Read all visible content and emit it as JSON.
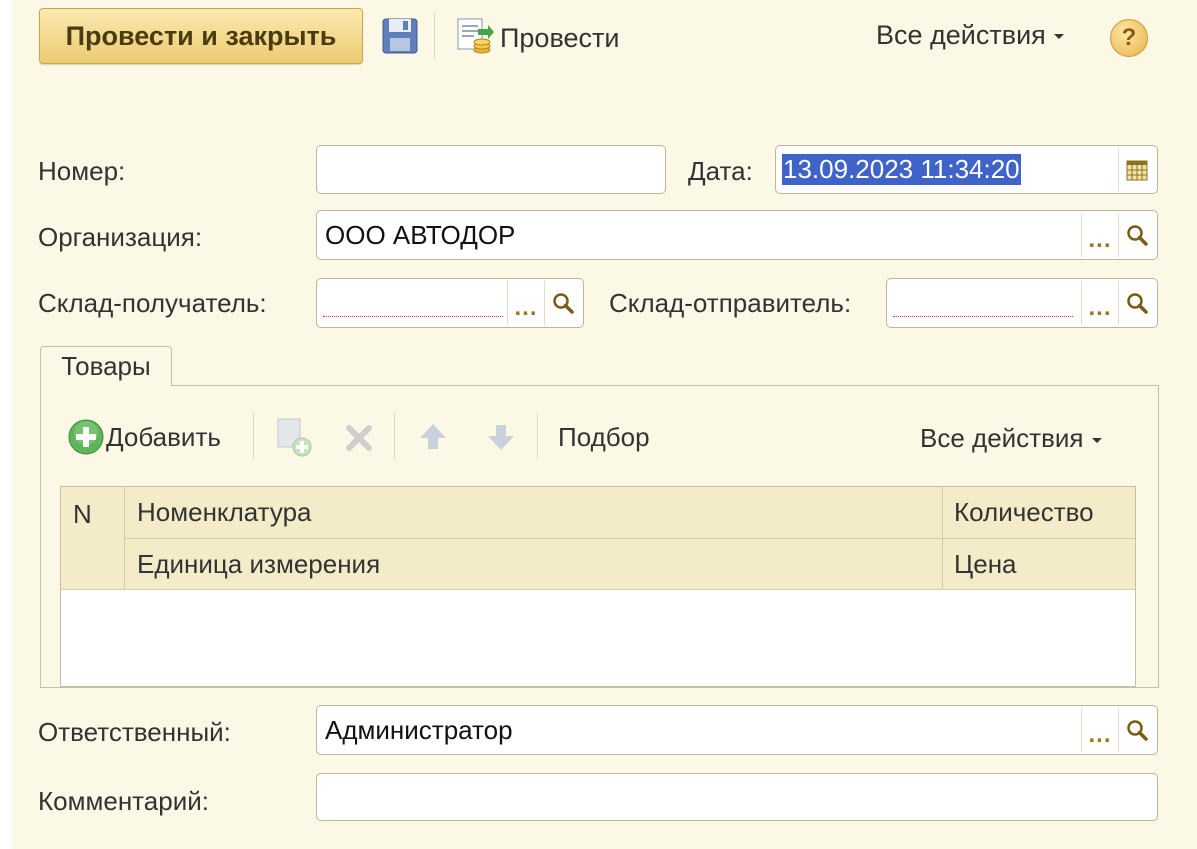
{
  "toolbar": {
    "post_and_close_label": "Провести и закрыть",
    "post_label": "Провести",
    "all_actions_label": "Все действия",
    "help_symbol": "?"
  },
  "form": {
    "number_label": "Номер:",
    "number_value": "",
    "date_label": "Дата:",
    "date_value": "13.09.2023 11:34:20",
    "organization_label": "Организация:",
    "organization_value": "ООО АВТОДОР",
    "warehouse_to_label": "Склад-получатель:",
    "warehouse_to_value": "",
    "warehouse_from_label": "Склад-отправитель:",
    "warehouse_from_value": "",
    "responsible_label": "Ответственный:",
    "responsible_value": "Администратор",
    "comment_label": "Комментарий:",
    "comment_value": ""
  },
  "goods_tab": {
    "tab_label": "Товары",
    "add_label": "Добавить",
    "selection_label": "Подбор",
    "all_actions_label": "Все действия",
    "columns": {
      "n": "N",
      "nomenclature": "Номенклатура",
      "quantity": "Количество",
      "unit": "Единица измерения",
      "price": "Цена"
    },
    "rows": []
  },
  "icons": {
    "save": "save-icon",
    "post": "post-document-icon",
    "help": "help-icon",
    "calendar": "calendar-icon",
    "select": "ellipsis-icon",
    "search": "magnifier-icon",
    "add": "add-circle-icon",
    "copy": "copy-icon",
    "delete": "delete-icon",
    "up": "arrow-up-icon",
    "down": "arrow-down-icon"
  },
  "colors": {
    "background": "#fbf8e6",
    "primary_button": "#eccb72",
    "selection": "#3f63c6",
    "header": "#f4ecc8"
  }
}
